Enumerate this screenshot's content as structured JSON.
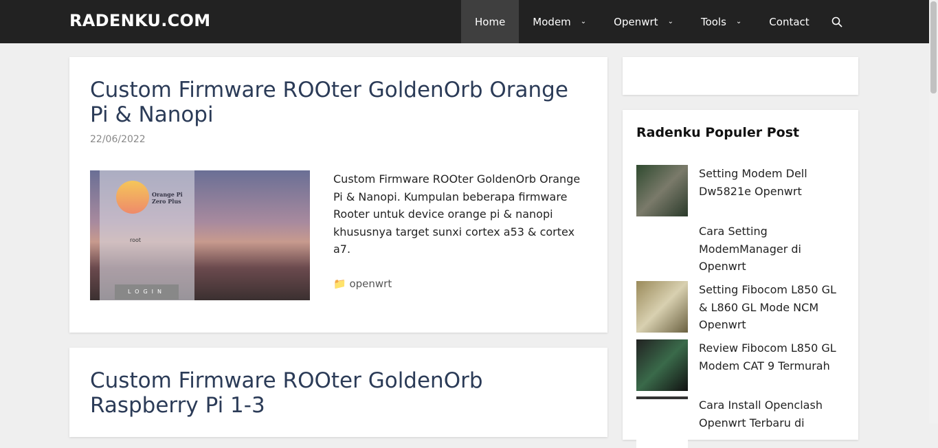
{
  "site": {
    "logo": "RADENKU.COM"
  },
  "nav": {
    "items": [
      {
        "label": "Home",
        "active": true
      },
      {
        "label": "Modem",
        "dropdown": true
      },
      {
        "label": "Openwrt",
        "dropdown": true
      },
      {
        "label": "Tools",
        "dropdown": true
      },
      {
        "label": "Contact"
      }
    ],
    "search_icon": "search-icon"
  },
  "posts": [
    {
      "title": "Custom Firmware ROOter GoldenOrb Orange Pi & Nanopi",
      "date": "22/06/2022",
      "excerpt": "Custom Firmware ROOter GoldenOrb Orange Pi & Nanopi. Kumpulan beberapa firmware Rooter untuk device orange pi & nanopi khususnya target sunxi cortex a53 & cortex a7.",
      "category": "openwrt",
      "thumb": {
        "device": "Orange Pi Zero Plus",
        "user": "root",
        "button": "LOGIN"
      }
    },
    {
      "title": "Custom Firmware ROOter GoldenOrb Raspberry Pi 1-3"
    }
  ],
  "sidebar": {
    "title": "Radenku Populer Post",
    "items": [
      {
        "title": "Setting Modem Dell Dw5821e Openwrt"
      },
      {
        "title": "Cara Setting ModemManager di Openwrt"
      },
      {
        "title": "Setting Fibocom L850 GL & L860 GL Mode NCM Openwrt"
      },
      {
        "title": "Review Fibocom L850 GL Modem CAT 9 Termurah"
      },
      {
        "title": "Cara Install Openclash Openwrt Terbaru di"
      }
    ]
  },
  "colors": {
    "nav_bg": "#222222",
    "title": "#2b3b57",
    "page_bg": "#efefef"
  }
}
